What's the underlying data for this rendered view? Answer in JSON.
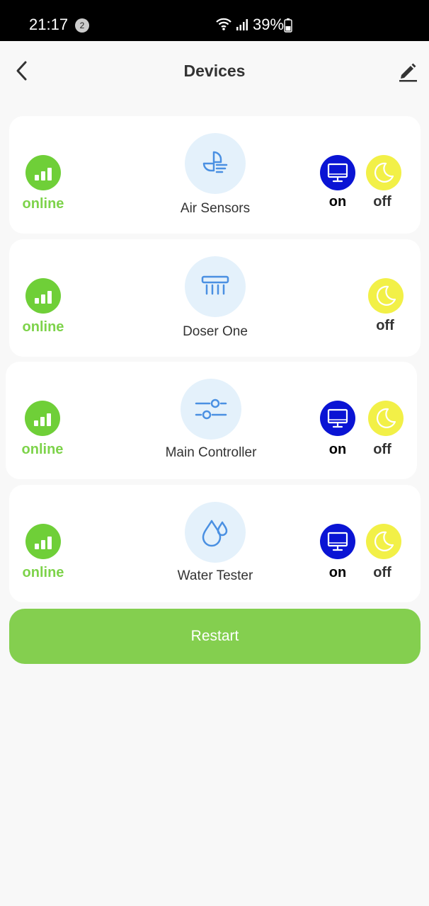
{
  "status_bar": {
    "time": "21:17",
    "notification_count": "2",
    "battery": "39%"
  },
  "header": {
    "title": "Devices"
  },
  "devices": [
    {
      "name": "Air Sensors",
      "status": "online",
      "on_label": "on",
      "off_label": "off",
      "icon": "fan-icon"
    },
    {
      "name": "Doser One",
      "status": "online",
      "off_label": "off",
      "icon": "doser-icon"
    },
    {
      "name": "Main Controller",
      "status": "online",
      "on_label": "on",
      "off_label": "off",
      "icon": "sliders-icon"
    },
    {
      "name": "Water Tester",
      "status": "online",
      "on_label": "on",
      "off_label": "off",
      "icon": "water-drop-icon"
    }
  ],
  "restart_label": "Restart",
  "colors": {
    "online_green": "#7dd34a",
    "on_blue": "#0a14d4",
    "off_yellow": "#f2f047",
    "accent_blue": "#4a90e2",
    "restart_green": "#84cf4f"
  }
}
